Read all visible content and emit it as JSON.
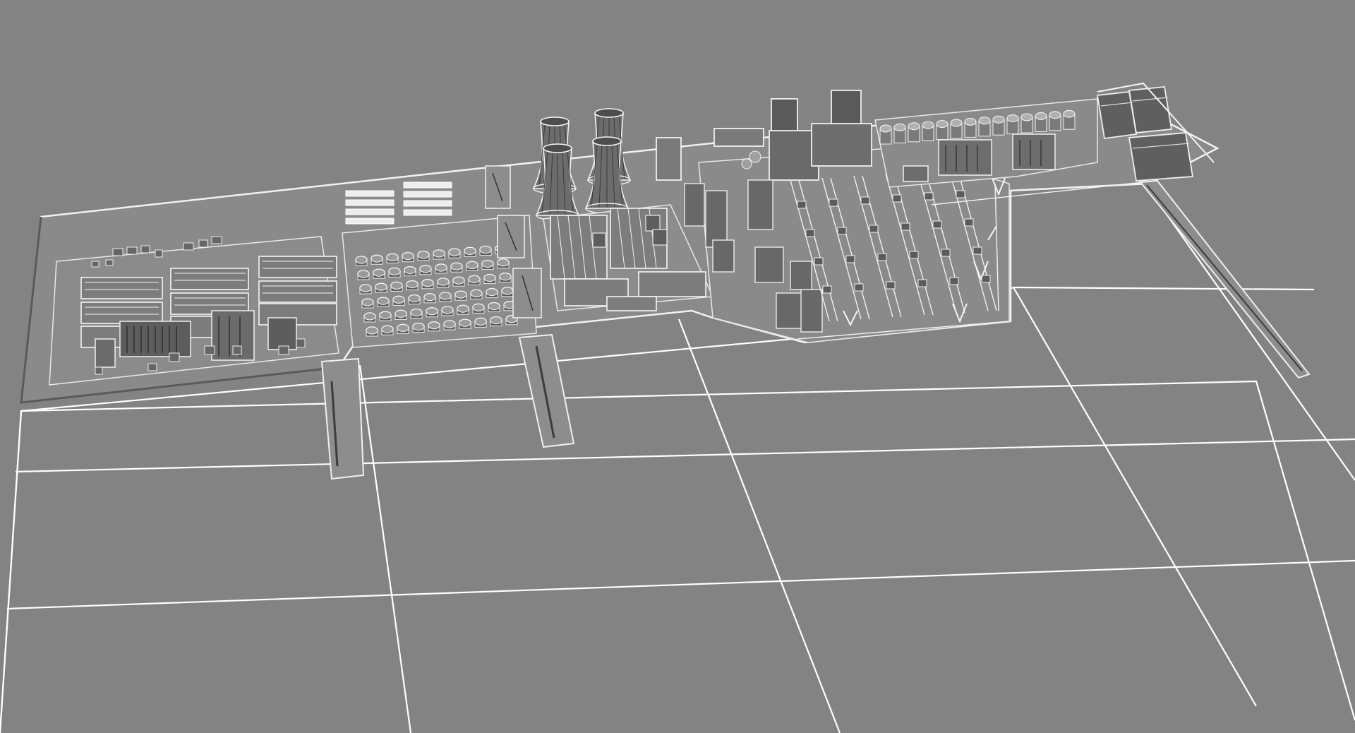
{
  "viewport": {
    "label": "",
    "background_color": "#838383",
    "grid_line_color": "#ffffff",
    "ground_color": "#8c8c8c",
    "model_outline_color": "#f0f0f0",
    "model_shade_color": "#6e6e6e",
    "model_dark_color": "#4a4a4a"
  },
  "scene": {
    "object": "industrial-plant-wireframe-model",
    "grid_visible": true,
    "zones": [
      {
        "name": "warehouse-blocks"
      },
      {
        "name": "tank-farm"
      },
      {
        "name": "cooling-towers",
        "count": 4
      },
      {
        "name": "production-halls"
      },
      {
        "name": "switchyard-substation"
      },
      {
        "name": "storage-silos"
      },
      {
        "name": "loading-sheds"
      },
      {
        "name": "jetty-piers",
        "count": 2
      }
    ]
  }
}
